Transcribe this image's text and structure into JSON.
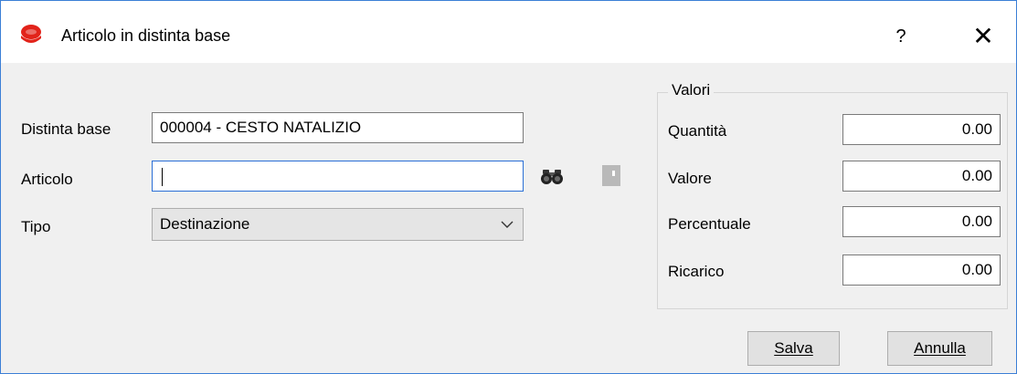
{
  "window": {
    "title": "Articolo in distinta base",
    "help_label": "?",
    "close_label": "✕"
  },
  "form": {
    "distinta_label": "Distinta base",
    "distinta_value": "000004 - CESTO NATALIZIO",
    "articolo_label": "Articolo",
    "articolo_value": "",
    "tipo_label": "Tipo",
    "tipo_value": "Destinazione"
  },
  "valori": {
    "group_title": "Valori",
    "quantita_label": "Quantità",
    "quantita_value": "0.00",
    "valore_label": "Valore",
    "valore_value": "0.00",
    "percentuale_label": "Percentuale",
    "percentuale_value": "0.00",
    "ricarico_label": "Ricarico",
    "ricarico_value": "0.00"
  },
  "buttons": {
    "save_label": "Salva",
    "cancel_label": "Annulla"
  },
  "icons": {
    "app": "app-logo-icon",
    "search": "binoculars-icon",
    "detail": "document-icon",
    "dropdown": "chevron-down-icon"
  },
  "colors": {
    "accent": "#2a6fd6",
    "logo_red": "#e2231a"
  }
}
